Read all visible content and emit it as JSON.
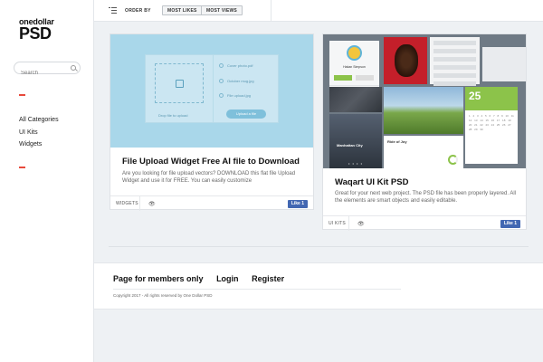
{
  "sidebar": {
    "logo_line1": "onedollar",
    "logo_line2": "PSD",
    "search_placeholder": "Search",
    "categories": [
      "All Categories",
      "UI Kits",
      "Widgets"
    ]
  },
  "topbar": {
    "order_by": "ORDER BY",
    "most_likes": "MOST LIKES",
    "most_views": "MOST VIEWS"
  },
  "cards": [
    {
      "title": "File Upload Widget Free AI file to Download",
      "description": "Are you looking for file upload vectors? DOWNLOAD this flat file Upload Widget and use it for FREE. You can easily customize",
      "tag": "WIDGETS",
      "like": "Like",
      "like_count": "1",
      "preview": {
        "rows": [
          "Cover photo.pdf",
          "October mug.jpg",
          "File upload.jpg"
        ],
        "browse": "Drop file to upload",
        "button": "Upload a file"
      }
    },
    {
      "title": "Waqart UI Kit PSD",
      "description": "Great for your next web project. The PSD file has been properly layered. All the elements are smart objects and easily editable.",
      "tag": "UI KITS",
      "like": "Like",
      "like_count": "1",
      "preview": {
        "date": "25",
        "city": "Manhattan City",
        "joy": "Ride of Joy",
        "profile": "Hakan Simpson"
      }
    }
  ],
  "footer": {
    "links": [
      "Page for members only",
      "Login",
      "Register"
    ],
    "copyright": "Copyright 2017 - All rights reserved by One Dollar PSD"
  },
  "colors": {
    "accent": "#e84a3c",
    "facebook": "#4267b2",
    "upload_bg": "#a9d7ea",
    "green": "#8cc34a"
  }
}
